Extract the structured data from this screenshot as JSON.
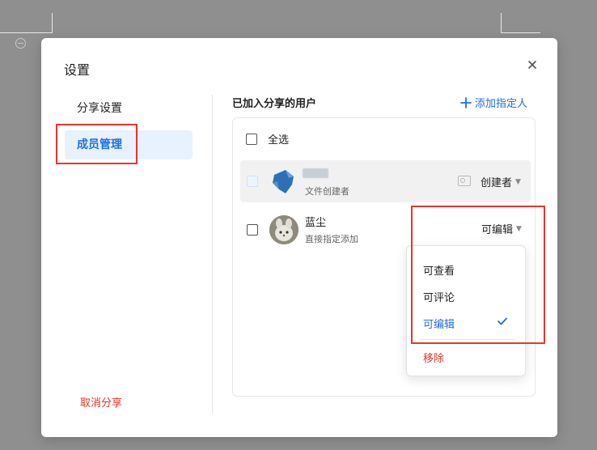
{
  "dialog": {
    "title": "设置",
    "close_icon": "close-icon"
  },
  "nav": {
    "items": [
      {
        "label": "分享设置",
        "active": false
      },
      {
        "label": "成员管理",
        "active": true
      }
    ],
    "cancel_share": "取消分享"
  },
  "members_section": {
    "title": "已加入分享的用户",
    "add_user": "添加指定人",
    "select_all": "全选",
    "rows": [
      {
        "name": "",
        "subtitle": "文件创建者",
        "role": "创建者"
      },
      {
        "name": "蓝尘",
        "subtitle": "直接指定添加",
        "role": "可编辑"
      }
    ]
  },
  "permission_menu": {
    "options": [
      "可查看",
      "可评论",
      "可编辑"
    ],
    "selected": "可编辑",
    "remove": "移除"
  },
  "colors": {
    "accent": "#1f6ee5",
    "danger": "#e0342c",
    "highlight_box": "#e8352e",
    "active_nav_bg": "#e8f1fe"
  }
}
